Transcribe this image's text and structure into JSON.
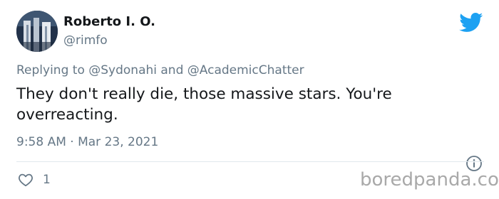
{
  "tweet": {
    "author": {
      "display_name": "Roberto I. O.",
      "handle": "@rimfo",
      "avatar_icon": "waterfall-photo-avatar"
    },
    "reply_prefix": "Replying to ",
    "reply_to": [
      "@Sydonahi",
      "@AcademicChatter"
    ],
    "reply_joiner": " and ",
    "text": "They don't really die, those massive stars. You're overreacting.",
    "timestamp": "9:58 AM · Mar 23, 2021",
    "likes": "1",
    "brand_icon": "twitter-bird-icon",
    "colors": {
      "brand_blue": "#1da1f2",
      "secondary_text": "#657786",
      "primary_text": "#14171a"
    }
  },
  "watermark": "boredpanda.com"
}
